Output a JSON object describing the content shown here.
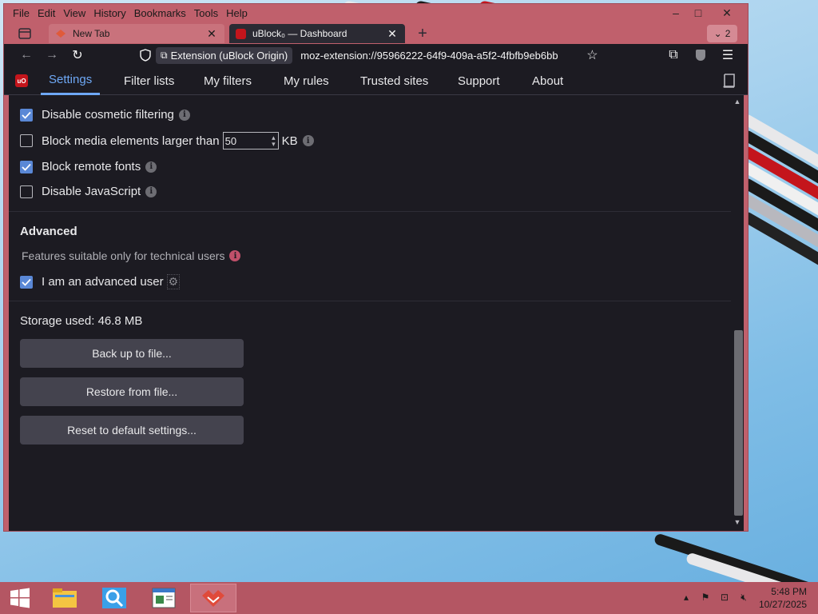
{
  "menubar": {
    "items": [
      "File",
      "Edit",
      "View",
      "History",
      "Bookmarks",
      "Tools",
      "Help"
    ]
  },
  "window_controls": {
    "minimize": "–",
    "maximize": "□",
    "close": "✕"
  },
  "tabs": {
    "items": [
      {
        "title": "New Tab",
        "active": false
      },
      {
        "title": "uBlock₀ — Dashboard",
        "active": true
      }
    ],
    "new_tab": "+",
    "tab_count": "2"
  },
  "navbar": {
    "identity_label": "Extension (uBlock Origin)",
    "url": "moz-extension://95966222-64f9-409a-a5f2-4fbfb9eb6bb"
  },
  "dashboard": {
    "logo": "uO",
    "tabs": [
      "Settings",
      "Filter lists",
      "My filters",
      "My rules",
      "Trusted sites",
      "Support",
      "About"
    ],
    "active_tab": "Settings"
  },
  "settings": {
    "disable_cosmetic_filtering": {
      "label": "Disable cosmetic filtering",
      "checked": true
    },
    "block_media": {
      "label_before": "Block media elements larger than",
      "value": "50",
      "label_after": "KB",
      "checked": false
    },
    "block_remote_fonts": {
      "label": "Block remote fonts",
      "checked": true
    },
    "disable_javascript": {
      "label": "Disable JavaScript",
      "checked": false
    }
  },
  "advanced": {
    "heading": "Advanced",
    "description": "Features suitable only for technical users",
    "advanced_user": {
      "label": "I am an advanced user",
      "checked": true
    }
  },
  "storage": {
    "label": "Storage used: 46.8 MB",
    "buttons": [
      "Back up to file...",
      "Restore from file...",
      "Reset to default settings..."
    ]
  },
  "taskbar": {
    "time": "5:48 PM",
    "date": "10/27/2025"
  },
  "colors": {
    "accent": "#6ea8f5",
    "checkbox": "#5a88d6",
    "window_frame": "#c0606c",
    "background": "#1c1b22"
  }
}
